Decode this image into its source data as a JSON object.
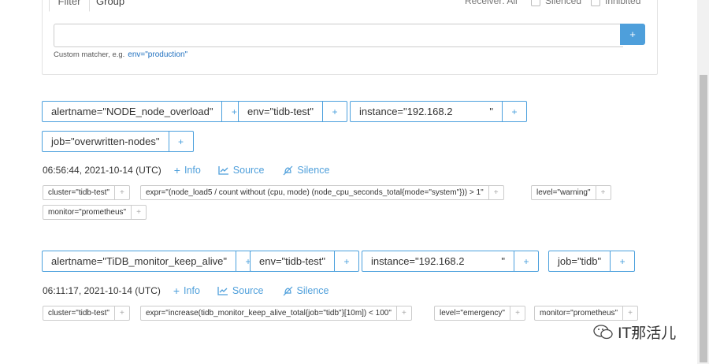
{
  "filter_panel": {
    "tabs": [
      "Filter",
      "Group"
    ],
    "receiver_text": "Receiver: All",
    "silenced_label": "Silenced",
    "inhibited_label": "Inhibited",
    "input_value": "",
    "add_button": "+",
    "hint_label": "Custom matcher, e.g.",
    "hint_example": "env=\"production\""
  },
  "groups": [
    {
      "labels": [
        "alertname=\"NODE_node_overload\"",
        "env=\"tidb-test\"",
        "instance=\"192.168.2             \"",
        "job=\"overwritten-nodes\""
      ],
      "alert": {
        "timestamp": "06:56:44, 2021-10-14 (UTC)",
        "info": "Info",
        "source": "Source",
        "silence": "Silence",
        "annotations": [
          "cluster=\"tidb-test\"",
          "expr=\"(node_load5 / count without (cpu, mode) (node_cpu_seconds_total{mode=\"system\"})) > 1\"",
          "level=\"warning\"",
          "monitor=\"prometheus\""
        ]
      }
    },
    {
      "labels": [
        "alertname=\"TiDB_monitor_keep_alive\"",
        "env=\"tidb-test\"",
        "instance=\"192.168.2             \"",
        "job=\"tidb\""
      ],
      "alert": {
        "timestamp": "06:11:17, 2021-10-14 (UTC)",
        "info": "Info",
        "source": "Source",
        "silence": "Silence",
        "annotations": [
          "cluster=\"tidb-test\"",
          "expr=\"increase(tidb_monitor_keep_alive_total{job=\"tidb\"}[10m]) < 100\"",
          "level=\"emergency\"",
          "monitor=\"prometheus\""
        ]
      }
    }
  ],
  "plus_symbol": "+",
  "watermark_text": "IT那活儿",
  "colors": {
    "accent": "#4ba0dd",
    "button": "#4e9fdb"
  }
}
